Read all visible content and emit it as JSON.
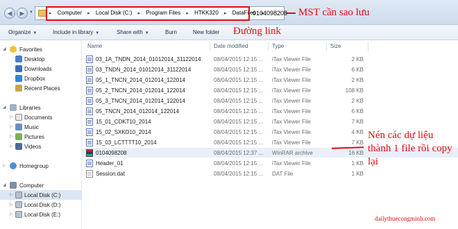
{
  "address": {
    "crumbs": [
      "Computer",
      "Local Disk (C:)",
      "Program Files",
      "HTKK320",
      "DataFiles",
      "0104098208"
    ]
  },
  "toolbar": {
    "organize": "Organize",
    "include": "Include in library",
    "share": "Share with",
    "burn": "Burn",
    "new_folder": "New folder"
  },
  "annotations": {
    "mst": "MST cần sao lưu",
    "link": "Đường link",
    "compress": "Nén các dự liệu thành 1 file rồi copy lại",
    "watermark": "dailythuecongminh.com"
  },
  "sidebar": {
    "favorites": "Favorites",
    "desktop": "Desktop",
    "downloads": "Downloads",
    "dropbox": "Dropbox",
    "recent": "Recent Places",
    "libraries": "Libraries",
    "documents": "Documents",
    "music": "Music",
    "pictures": "Pictures",
    "videos": "Videos",
    "homegroup": "Homegroup",
    "computer": "Computer",
    "disk_c": "Local Disk (C:)",
    "disk_d": "Local Disk (D:)",
    "disk_e": "Local Disk (E:)"
  },
  "columns": {
    "name": "Name",
    "date": "Date modified",
    "type": "Type",
    "size": "Size"
  },
  "files": [
    {
      "name": "03_1A_TNDN_2014_01012014_31122014",
      "date": "08/04/2015 12:15 ...",
      "type": "iTax Viewer File",
      "size": "2 KB"
    },
    {
      "name": "03_TNDN_2014_01012014_31122014",
      "date": "08/04/2015 12:15 ...",
      "type": "iTax Viewer File",
      "size": "6 KB"
    },
    {
      "name": "05_1_TNCN_2014_012014_122014",
      "date": "08/04/2015 12:15 ...",
      "type": "iTax Viewer File",
      "size": "2 KB"
    },
    {
      "name": "05_2_TNCN_2014_012014_122014",
      "date": "08/04/2015 12:15 ...",
      "type": "iTax Viewer File",
      "size": "108 KB"
    },
    {
      "name": "05_3_TNCN_2014_012014_122014",
      "date": "08/04/2015 12:15 ...",
      "type": "iTax Viewer File",
      "size": "2 KB"
    },
    {
      "name": "05_TNCN_2014_012014_122014",
      "date": "08/04/2015 12:15 ...",
      "type": "iTax Viewer File",
      "size": "6 KB"
    },
    {
      "name": "15_01_CDKT10_2014",
      "date": "08/04/2015 12:15 ...",
      "type": "iTax Viewer File",
      "size": "7 KB"
    },
    {
      "name": "15_02_SXKD10_2014",
      "date": "08/04/2015 12:15 ...",
      "type": "iTax Viewer File",
      "size": "4 KB"
    },
    {
      "name": "15_03_LCTTTT10_2014",
      "date": "08/04/2015 12:15 ...",
      "type": "iTax Viewer File",
      "size": "7 KB"
    },
    {
      "name": "0104098208",
      "date": "08/04/2015 12:37 ...",
      "type": "WinRAR archive",
      "size": "16 KB"
    },
    {
      "name": "Header_01",
      "date": "08/04/2015 12:15 ...",
      "type": "iTax Viewer File",
      "size": "1 KB"
    },
    {
      "name": "Session.dat",
      "date": "08/04/2015 12:15 ...",
      "type": "DAT File",
      "size": "1 KB"
    }
  ]
}
